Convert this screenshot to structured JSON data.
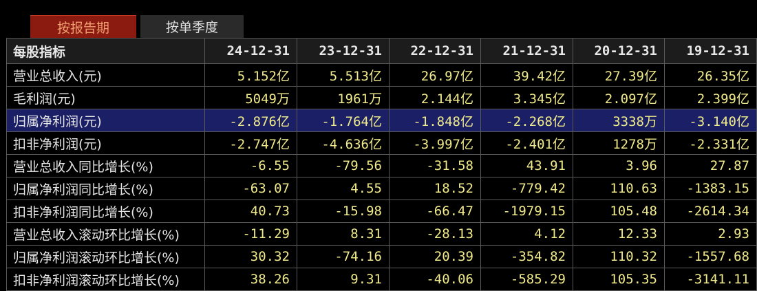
{
  "tabs": {
    "by_report_period": "按报告期",
    "by_single_quarter": "按单季度"
  },
  "table": {
    "header_label": "每股指标",
    "columns": [
      "24-12-31",
      "23-12-31",
      "22-12-31",
      "21-12-31",
      "20-12-31",
      "19-12-31"
    ],
    "rows": [
      {
        "label": "营业总收入(元)",
        "values": [
          "5.152亿",
          "5.513亿",
          "26.97亿",
          "39.42亿",
          "27.39亿",
          "26.35亿"
        ]
      },
      {
        "label": "毛利润(元)",
        "values": [
          "5049万",
          "1961万",
          "2.144亿",
          "3.345亿",
          "2.097亿",
          "2.399亿"
        ]
      },
      {
        "label": "归属净利润(元)",
        "values": [
          "-2.876亿",
          "-1.764亿",
          "-1.848亿",
          "-2.268亿",
          "3338万",
          "-3.140亿"
        ]
      },
      {
        "label": "扣非净利润(元)",
        "values": [
          "-2.747亿",
          "-4.636亿",
          "-3.997亿",
          "-2.401亿",
          "1278万",
          "-2.331亿"
        ]
      },
      {
        "label": "营业总收入同比增长(%)",
        "values": [
          "-6.55",
          "-79.56",
          "-31.58",
          "43.91",
          "3.96",
          "27.87"
        ]
      },
      {
        "label": "归属净利润同比增长(%)",
        "values": [
          "-63.07",
          "4.55",
          "18.52",
          "-779.42",
          "110.63",
          "-1383.15"
        ]
      },
      {
        "label": "扣非净利润同比增长(%)",
        "values": [
          "40.73",
          "-15.98",
          "-66.47",
          "-1979.15",
          "105.48",
          "-2614.34"
        ]
      },
      {
        "label": "营业总收入滚动环比增长(%)",
        "values": [
          "-11.29",
          "8.31",
          "-28.13",
          "4.12",
          "12.33",
          "2.93"
        ]
      },
      {
        "label": "归属净利润滚动环比增长(%)",
        "values": [
          "30.32",
          "-74.16",
          "20.39",
          "-354.82",
          "110.32",
          "-1557.68"
        ]
      },
      {
        "label": "扣非净利润滚动环比增长(%)",
        "values": [
          "38.26",
          "9.31",
          "-40.06",
          "-585.29",
          "105.35",
          "-3141.11"
        ]
      }
    ]
  },
  "colors": {
    "active_tab_bg": "#8b1a10",
    "active_tab_text": "#f0a070",
    "highlight_row_bg": "#1a1f66",
    "value_text": "#f0ea8a"
  }
}
